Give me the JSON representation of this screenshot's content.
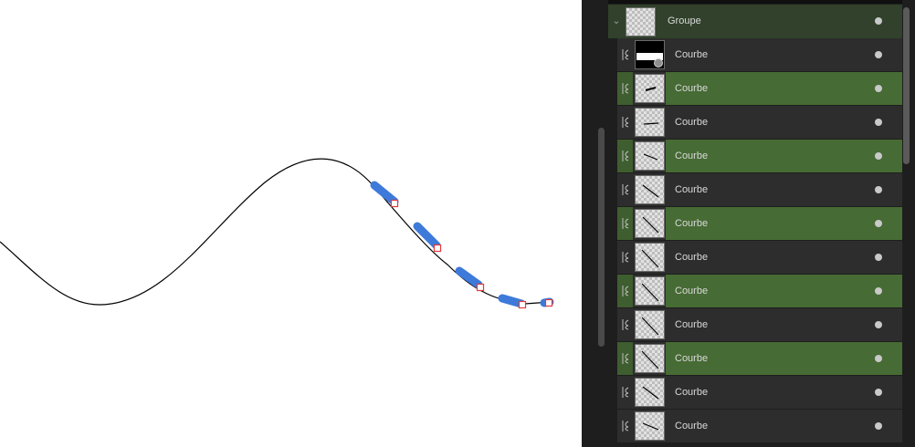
{
  "layers_panel": {
    "group": {
      "label": "Groupe",
      "expanded": true,
      "visible": true
    },
    "items": [
      {
        "label": "Courbe",
        "kind": "mask",
        "selected": false,
        "visible": true
      },
      {
        "label": "Courbe",
        "kind": "curve",
        "selected": true,
        "visible": true
      },
      {
        "label": "Courbe",
        "kind": "curve",
        "selected": false,
        "visible": true
      },
      {
        "label": "Courbe",
        "kind": "curve",
        "selected": true,
        "visible": true
      },
      {
        "label": "Courbe",
        "kind": "curve",
        "selected": false,
        "visible": true
      },
      {
        "label": "Courbe",
        "kind": "curve",
        "selected": true,
        "visible": true
      },
      {
        "label": "Courbe",
        "kind": "curve",
        "selected": false,
        "visible": true
      },
      {
        "label": "Courbe",
        "kind": "curve",
        "selected": true,
        "visible": true
      },
      {
        "label": "Courbe",
        "kind": "curve",
        "selected": false,
        "visible": true
      },
      {
        "label": "Courbe",
        "kind": "curve",
        "selected": true,
        "visible": true
      },
      {
        "label": "Courbe",
        "kind": "curve",
        "selected": false,
        "visible": true
      },
      {
        "label": "Courbe",
        "kind": "curve",
        "selected": false,
        "visible": true
      }
    ]
  },
  "colors": {
    "selection_green": "#466b34",
    "group_green": "#31412b",
    "row_dark": "#2d2d2d",
    "panel_bg": "#1e1e1e",
    "curve_stroke": "#000000",
    "segment_blue": "#3d7ad9",
    "node_red": "#e23b3b"
  },
  "icons": {
    "expand": "chevron-down-icon",
    "layer_type": "curve-layer-icon",
    "visibility": "visibility-dot-icon"
  }
}
